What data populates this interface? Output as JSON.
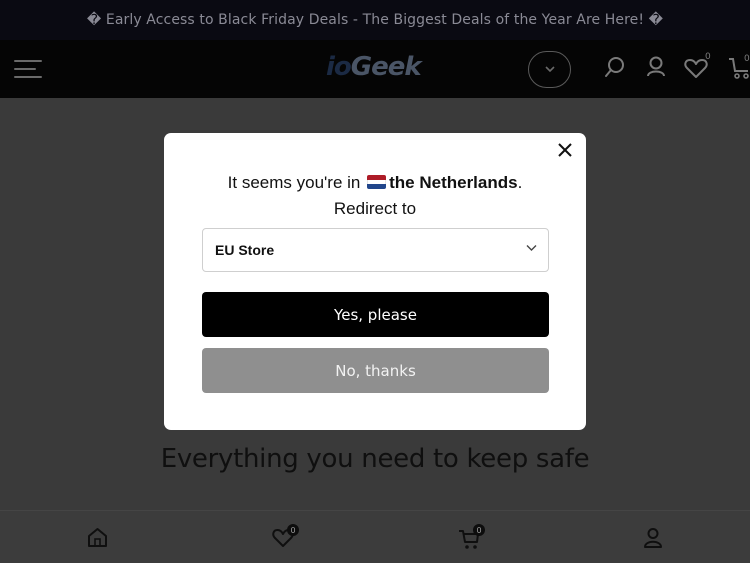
{
  "announcement": "� Early Access to Black Friday Deals - The Biggest Deals of the Year Are Here! �",
  "header": {
    "logo_part1": "io",
    "logo_part2": "Geek",
    "wishlist_count": "0",
    "cart_count": "0"
  },
  "page": {
    "heading": "Everything you need to keep safe"
  },
  "bottom_nav": {
    "wishlist_count": "0",
    "cart_count": "0"
  },
  "modal": {
    "line1_prefix": "It seems you're in",
    "country": "the Netherlands",
    "line1_suffix": ".",
    "line2": "Redirect to",
    "selected_store": "EU Store",
    "yes_label": "Yes, please",
    "no_label": "No, thanks"
  },
  "icons": {
    "menu": "hamburger-icon",
    "currency": "chevron-down-icon",
    "search": "search-icon",
    "account": "user-icon",
    "wishlist": "heart-icon",
    "cart": "cart-icon",
    "home": "home-icon",
    "close": "close-icon",
    "flag": "netherlands-flag-icon"
  },
  "colors": {
    "flag_red": "#AE1C28",
    "flag_white": "#FFFFFF",
    "flag_blue": "#21468B",
    "primary_button": "#000000",
    "secondary_button": "#8F8F8F"
  }
}
